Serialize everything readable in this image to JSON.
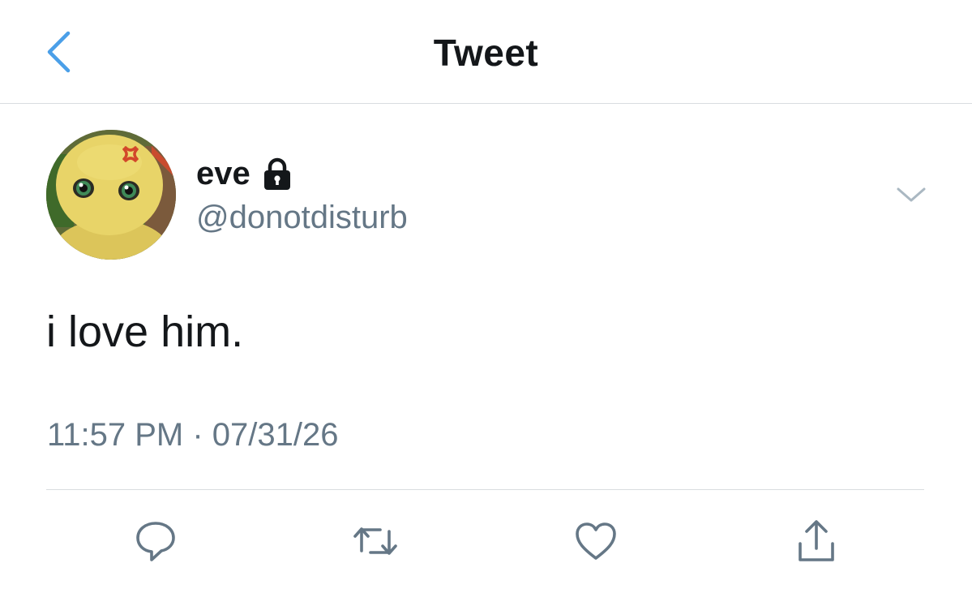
{
  "header": {
    "title": "Tweet",
    "back_icon": "chevron-left-icon",
    "accent_color": "#4a9fe8"
  },
  "tweet": {
    "author": {
      "display_name": "eve",
      "handle": "@donotdisturb",
      "protected_icon": "lock-icon"
    },
    "text": "i love him.",
    "timestamp": "11:57 PM · 07/31/26",
    "menu_icon": "chevron-down-icon"
  },
  "actions": [
    {
      "name": "reply",
      "icon": "speech-bubble-icon"
    },
    {
      "name": "retweet",
      "icon": "retweet-icon"
    },
    {
      "name": "like",
      "icon": "heart-icon"
    },
    {
      "name": "share",
      "icon": "share-icon"
    }
  ],
  "colors": {
    "primary_text": "#14171a",
    "secondary_text": "#657786",
    "divider": "#d9dde0"
  }
}
